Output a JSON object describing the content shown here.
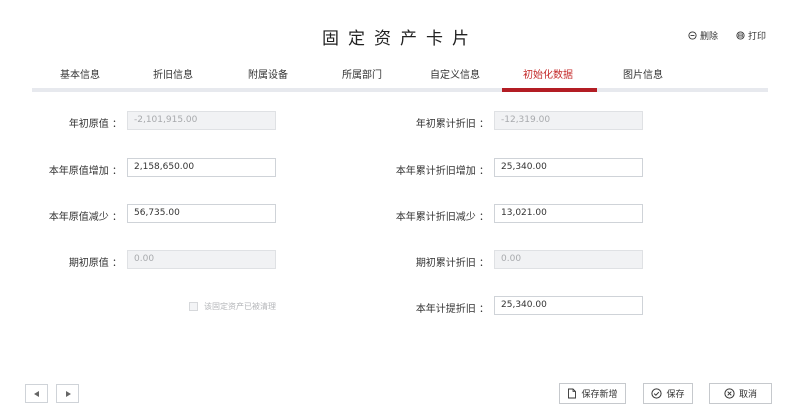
{
  "page": {
    "title": "固定资产卡片"
  },
  "top_actions": {
    "delete_label": "删除",
    "print_label": "打印"
  },
  "tabs": [
    {
      "label": "基本信息"
    },
    {
      "label": "折旧信息"
    },
    {
      "label": "附属设备"
    },
    {
      "label": "所属部门"
    },
    {
      "label": "自定义信息"
    },
    {
      "label": "初始化数据",
      "active": true
    },
    {
      "label": "图片信息"
    }
  ],
  "form": {
    "left": [
      {
        "label": "年初原值 ：",
        "value": "-2,101,915.00",
        "disabled": true
      },
      {
        "label": "本年原值增加 ：",
        "value": "2,158,650.00",
        "disabled": false
      },
      {
        "label": "本年原值减少 ：",
        "value": "56,735.00",
        "disabled": false
      },
      {
        "label": "期初原值 ：",
        "value": "0.00",
        "disabled": true
      }
    ],
    "right": [
      {
        "label": "年初累计折旧 ：",
        "value": "-12,319.00",
        "disabled": true
      },
      {
        "label": "本年累计折旧增加 ：",
        "value": "25,340.00",
        "disabled": false
      },
      {
        "label": "本年累计折旧减少 ：",
        "value": "13,021.00",
        "disabled": false
      },
      {
        "label": "期初累计折旧 ：",
        "value": "0.00",
        "disabled": true
      },
      {
        "label": "本年计提折旧 ：",
        "value": "25,340.00",
        "disabled": false
      }
    ],
    "cleared_checkbox_label": "该固定资产已被清理"
  },
  "footer": {
    "save_new_label": "保存新增",
    "save_label": "保存",
    "cancel_label": "取消"
  },
  "colors": {
    "accent": "#b31d24",
    "active_tab_text": "#c42b2b",
    "divider": "#e7e9ee"
  }
}
